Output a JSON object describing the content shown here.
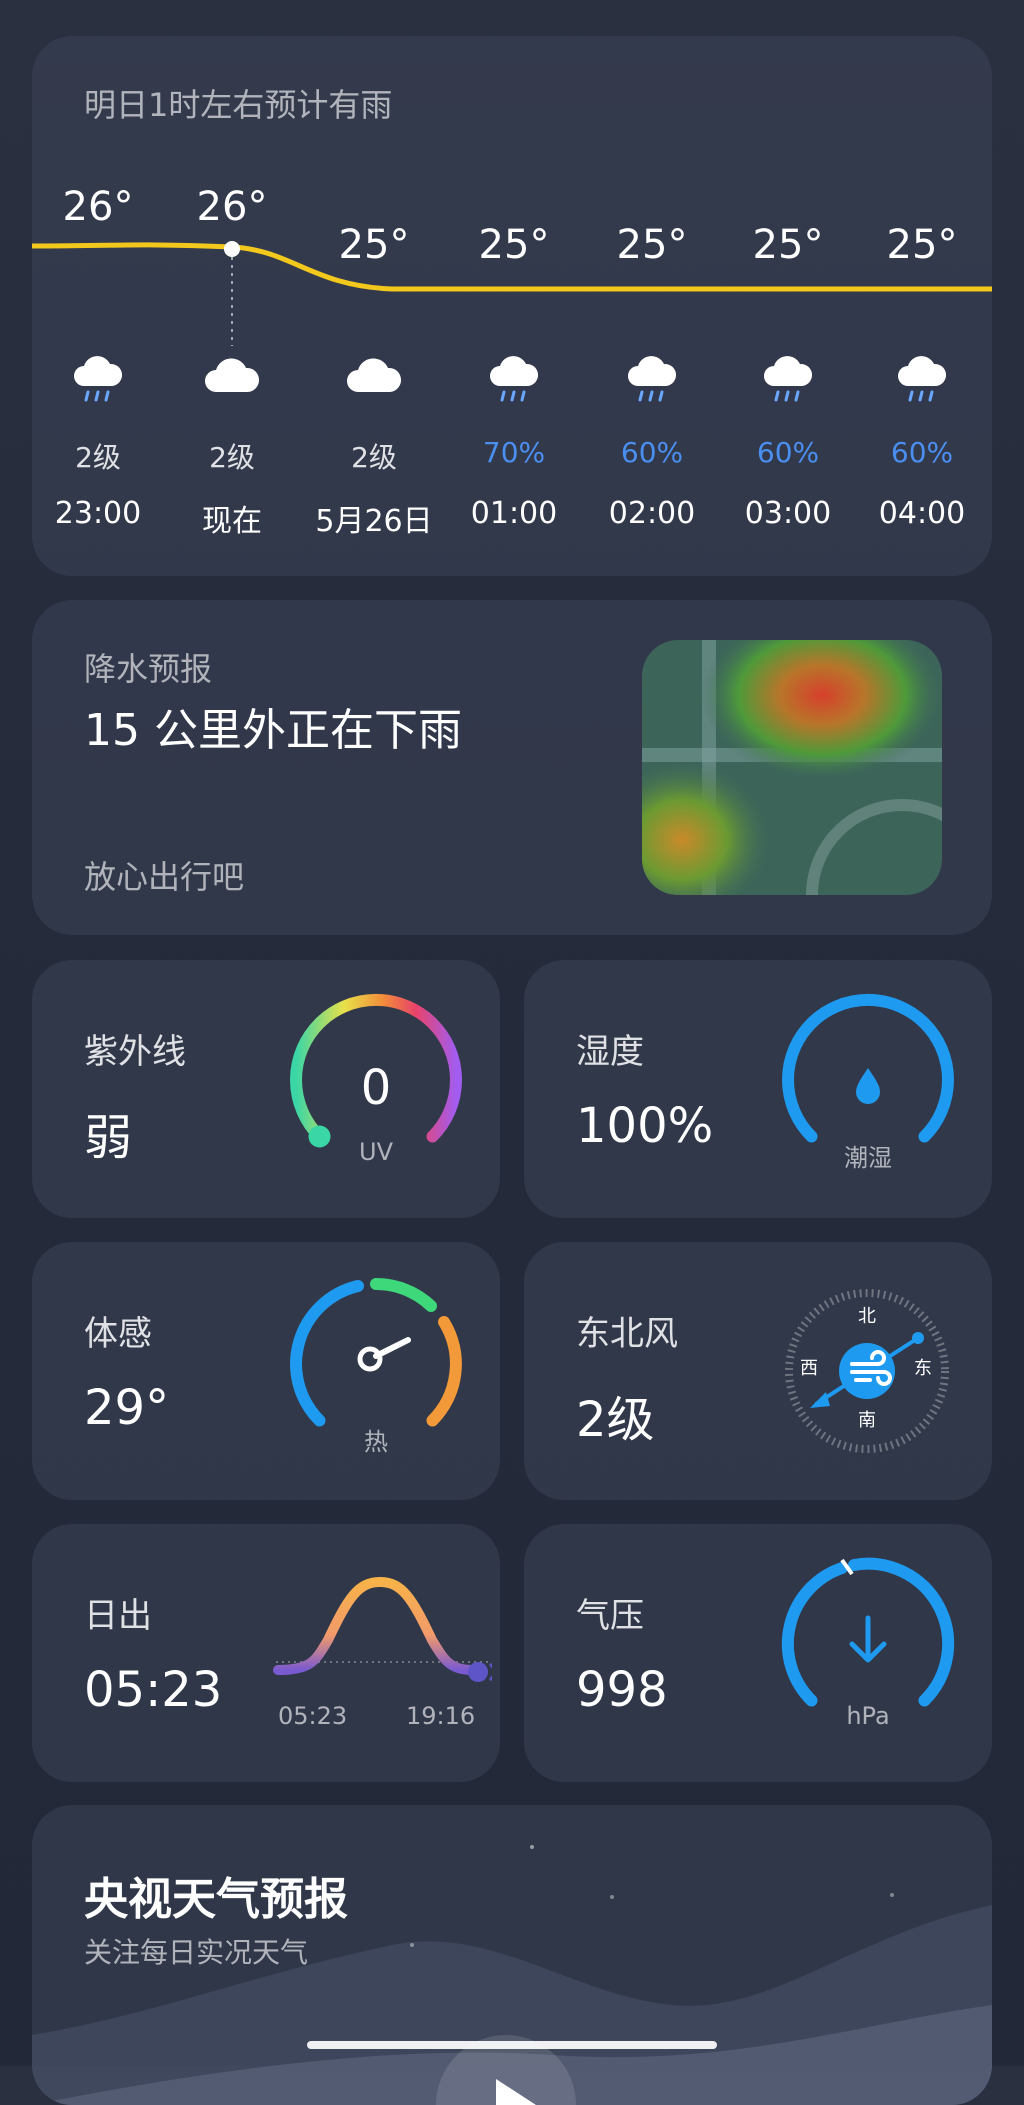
{
  "hourly": {
    "title": "明日1时左右预计有雨",
    "items": [
      {
        "temp": "26°",
        "icon": "rain-cloud-icon",
        "level": "2级",
        "time": "23:00"
      },
      {
        "temp": "26°",
        "icon": "cloud-icon",
        "level": "2级",
        "time": "现在"
      },
      {
        "temp": "25°",
        "icon": "cloud-icon",
        "level": "2级",
        "time": "5月26日"
      },
      {
        "temp": "25°",
        "icon": "rain-cloud-icon",
        "level": "70%",
        "time": "01:00"
      },
      {
        "temp": "25°",
        "icon": "rain-cloud-icon",
        "level": "60%",
        "time": "02:00"
      },
      {
        "temp": "25°",
        "icon": "rain-cloud-icon",
        "level": "60%",
        "time": "03:00"
      },
      {
        "temp": "25°",
        "icon": "rain-cloud-icon",
        "level": "60%",
        "time": "04:00"
      }
    ],
    "line_color": "#f2c81d",
    "rain_prob_color": "#4a8ff0"
  },
  "precip": {
    "title": "降水预报",
    "headline": "15 公里外正在下雨",
    "subtitle": "放心出行吧"
  },
  "uv": {
    "label": "紫外线",
    "value": "弱",
    "index": "0",
    "unit": "UV"
  },
  "humidity": {
    "label": "湿度",
    "value": "100%",
    "desc": "潮湿",
    "color": "#1e9bf0"
  },
  "feels_like": {
    "label": "体感",
    "value": "29°",
    "desc": "热"
  },
  "wind": {
    "label": "东北风",
    "value": "2级",
    "dirs": {
      "north": "北",
      "south": "南",
      "east": "东",
      "west": "西"
    }
  },
  "sunrise": {
    "label": "日出",
    "value": "05:23",
    "rise": "05:23",
    "set": "19:16"
  },
  "pressure": {
    "label": "气压",
    "value": "998",
    "unit": "hPa"
  },
  "cctv": {
    "title": "央视天气预报",
    "subtitle": "关注每日实况天气"
  }
}
